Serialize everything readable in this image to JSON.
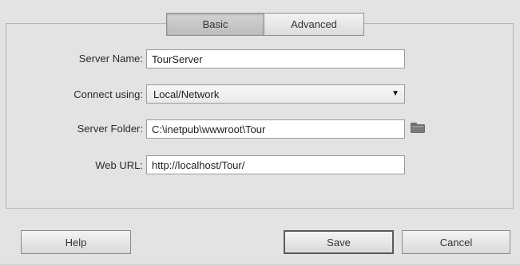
{
  "tabs": {
    "basic": "Basic",
    "advanced": "Advanced"
  },
  "form": {
    "server_name": {
      "label": "Server Name:",
      "value": "TourServer"
    },
    "connect_using": {
      "label": "Connect using:",
      "value": "Local/Network"
    },
    "server_folder": {
      "label": "Server Folder:",
      "value": "C:\\inetpub\\wwwroot\\Tour"
    },
    "web_url": {
      "label": "Web URL:",
      "value": "http://localhost/Tour/"
    }
  },
  "icons": {
    "folder": "folder-browse-icon",
    "dropdown": "dropdown-arrow-icon"
  },
  "buttons": {
    "help": "Help",
    "save": "Save",
    "cancel": "Cancel"
  }
}
